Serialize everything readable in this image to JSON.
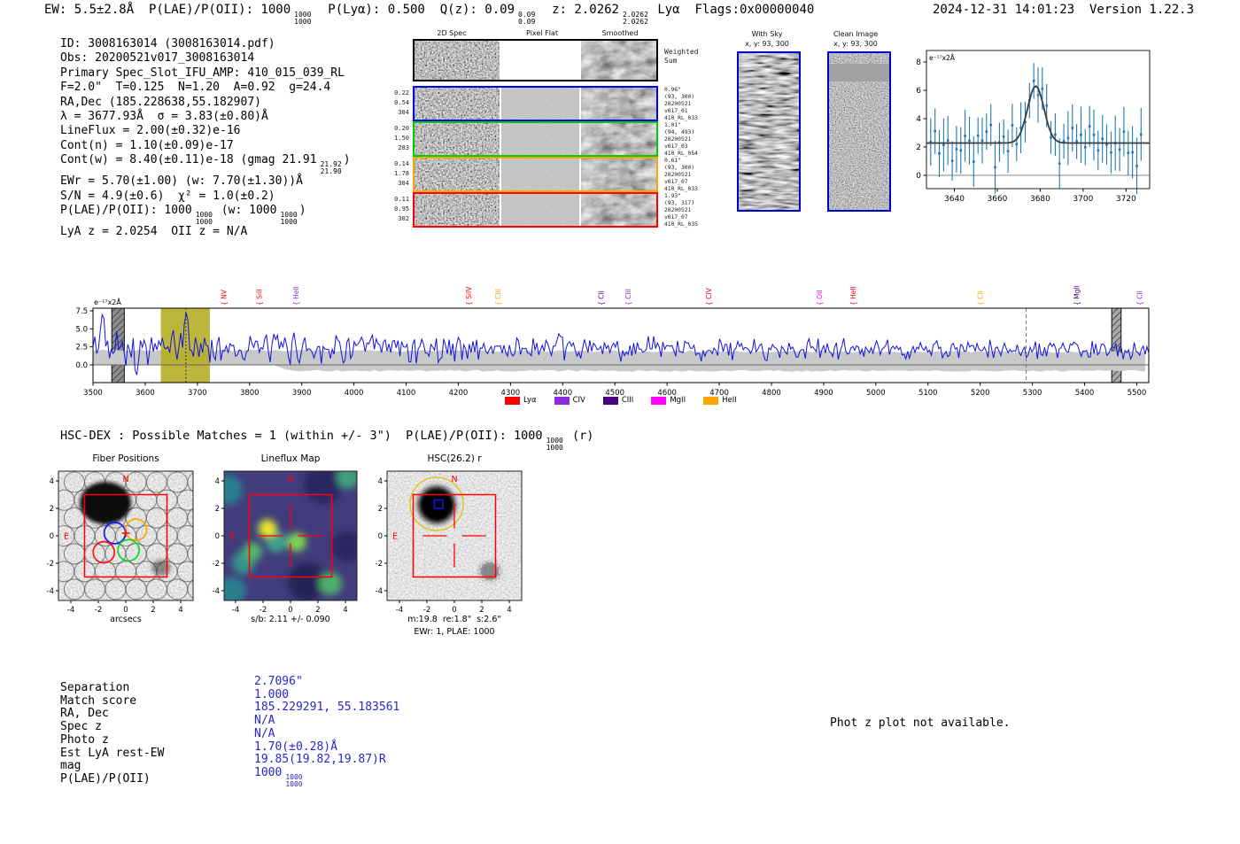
{
  "meta": {
    "stamp": "2024-12-31 14:01:23  Version 1.22.3"
  },
  "header_segments": [
    {
      "t": "EW: 5.5±2.8Å  P(LAE)/P(OII): 1000"
    },
    {
      "f": [
        "1000",
        "1000"
      ]
    },
    {
      "t": "  P(Lyα): 0.500  Q(z): 0.09"
    },
    {
      "f": [
        "0.09",
        "0.09"
      ]
    },
    {
      "t": "  z: 2.0262"
    },
    {
      "f": [
        "2.0262",
        "2.0262"
      ]
    },
    {
      "t": " Lyα  Flags:0x00000040"
    }
  ],
  "info_lines": [
    [
      {
        "t": "ID: 3008163014 (3008163014.pdf)"
      }
    ],
    [
      {
        "t": "Obs: 20200521v017_3008163014"
      }
    ],
    [
      {
        "t": "Primary Spec_Slot_IFU_AMP: 410_015_039_RL"
      }
    ],
    [
      {
        "t": "F=2.0\"  T=0.125  N=1.20  A=0.92  g=24.4"
      }
    ],
    [
      {
        "t": "RA,Dec (185.228638,55.182907)"
      }
    ],
    [
      {
        "t": "λ = 3677.93Å  σ = 3.83(±0.80)Å"
      }
    ],
    [
      {
        "t": "LineFlux = 2.00(±0.32)e-16"
      }
    ],
    [
      {
        "t": "Cont(n) = 1.10(±0.09)e-17"
      }
    ],
    [
      {
        "t": "Cont(w) = 8.40(±0.11)e-18 (gmag 21.91"
      },
      {
        "f": [
          "21.92",
          "21.90"
        ]
      },
      {
        "t": ")"
      }
    ],
    [
      {
        "t": "EWr = 5.70(±1.00) (w: 7.70(±1.30))Å"
      }
    ],
    [
      {
        "t": "S/N = 4.9(±0.6)  χ² = 1.0(±0.2)"
      }
    ],
    [
      {
        "t": "P(LAE)/P(OII): 1000"
      },
      {
        "f": [
          "1000",
          "1000"
        ]
      },
      {
        "t": " (w: 1000"
      },
      {
        "f": [
          "1000",
          "1000"
        ]
      },
      {
        "t": ")"
      }
    ],
    [
      {
        "t": "LyA z = 2.0254  OII z = N/A"
      }
    ]
  ],
  "spec2d": {
    "col_titles": [
      "2D Spec",
      "Pixel Flat",
      "Smoothed"
    ],
    "rows": [
      {
        "border": "#000000",
        "left": [],
        "right_lines": [
          "Weighted",
          "Sum"
        ]
      },
      {
        "border": "#0000ee",
        "left": [
          "0.22",
          "0.54",
          "304"
        ],
        "right_lines": [
          "0.96\"",
          "(93, 300)",
          "20200521",
          "v017_01",
          "410_RL_033"
        ]
      },
      {
        "border": "#00cc00",
        "left": [
          "0.20",
          "1.50",
          "283"
        ],
        "right_lines": [
          "1.01\"",
          "(94, 493)",
          "20200521",
          "v017_03",
          "410_RL_054"
        ]
      },
      {
        "border": "#ffa500",
        "left": [
          "0.14",
          "1.78",
          "304"
        ],
        "right_lines": [
          "0.61\"",
          "(93, 300)",
          "20200521",
          "v017_07",
          "410_RL_033"
        ]
      },
      {
        "border": "#ff0000",
        "left": [
          "0.11",
          "0.95",
          "302"
        ],
        "right_lines": [
          "1.93\"",
          "(93, 317)",
          "20200521",
          "v017_07",
          "410_RL_035"
        ]
      }
    ]
  },
  "sky_panels": [
    {
      "title": "With Sky",
      "subtitle": "x, y: 93, 300"
    },
    {
      "title": "Clean Image",
      "subtitle": "x, y: 93, 300"
    }
  ],
  "chart_data": [
    {
      "id": "emission-line-fit",
      "type": "scatter",
      "title": "",
      "xlabel": "",
      "ylabel": "e⁻¹⁷x2Å",
      "xlim": [
        3627,
        3731
      ],
      "ylim": [
        -0.94,
        8.81
      ],
      "xticks": [
        3640,
        3660,
        3680,
        3700,
        3720
      ],
      "yticks": [
        0,
        2,
        4,
        6,
        8
      ],
      "fit_curve": {
        "shape": "gaussian",
        "center": 3677.93,
        "sigma": 3.83,
        "baseline": 2.28,
        "peak": 6.3
      },
      "points": {
        "x_start": 3629,
        "x_step": 2,
        "count": 50,
        "baseline": 2.28,
        "scatter": 1.9,
        "typical_error": 1.55
      },
      "marker_color": "#1f77b4",
      "curve_color": "#3c3c3c",
      "grid": false
    },
    {
      "id": "full-spectrum",
      "type": "line",
      "title": "",
      "xlabel": "",
      "ylabel": "e⁻¹⁷x2Å",
      "xlim": [
        3500,
        5523
      ],
      "ylim": [
        -2.46,
        7.87
      ],
      "xticks": [
        3500,
        3600,
        3700,
        3800,
        3900,
        4000,
        4100,
        4200,
        4300,
        4400,
        4500,
        4600,
        4700,
        4800,
        4900,
        5000,
        5100,
        5200,
        5300,
        5400,
        5500
      ],
      "yticks": [
        0.0,
        2.5,
        5.0,
        7.5
      ],
      "line_color": "#1212e0",
      "baseline_flux": 2.3,
      "emission_peak": {
        "wavelength": 3677.93,
        "flux": 6.8
      },
      "extra_peak": {
        "wavelength": 3520,
        "flux": 7.3
      },
      "noise_band_color": "#c9c9c9",
      "highlight_band": {
        "x0": 3630,
        "x1": 3724,
        "color": "#b5ab20"
      },
      "dotted_line_x": 3677.93,
      "dashed_line_x": 5288,
      "hatched_bands": [
        [
          3536,
          3560
        ],
        [
          5452,
          5470
        ]
      ],
      "line_labels": [
        {
          "name": "NV",
          "wave": 3755,
          "color": "#ff0000"
        },
        {
          "name": "SiII",
          "wave": 3823,
          "color": "#ff0000"
        },
        {
          "name": "HeII",
          "wave": 3894,
          "color": "#8a2be2"
        },
        {
          "name": "SiIV",
          "wave": 4225,
          "color": "#ff0000"
        },
        {
          "name": "CIII",
          "wave": 4281,
          "color": "#ffa500"
        },
        {
          "name": "CII",
          "wave": 4478,
          "color": "#4b0082"
        },
        {
          "name": "CIII",
          "wave": 4530,
          "color": "#8a2be2"
        },
        {
          "name": "CIV",
          "wave": 4685,
          "color": "#ff0000"
        },
        {
          "name": "OII",
          "wave": 4897,
          "color": "#ff00ff"
        },
        {
          "name": "HeII",
          "wave": 4961,
          "color": "#ff0000"
        },
        {
          "name": "CII",
          "wave": 5205,
          "color": "#ffa500"
        },
        {
          "name": "MgII",
          "wave": 5390,
          "color": "#4b0082"
        },
        {
          "name": "CII",
          "wave": 5510,
          "color": "#8a2be2"
        }
      ],
      "legend": {
        "position": "bottom",
        "items": [
          {
            "label": "Lyα",
            "color": "#ff0000"
          },
          {
            "label": "CIV",
            "color": "#8a2be2"
          },
          {
            "label": "CIII",
            "color": "#4b0082"
          },
          {
            "label": "MgII",
            "color": "#ff00ff"
          },
          {
            "label": "HeII",
            "color": "#ffa500"
          }
        ]
      }
    }
  ],
  "hsc_segments": [
    {
      "t": "HSC-DEX : Possible Matches = 1 (within +/- 3\")  P(LAE)/P(OII): 1000"
    },
    {
      "f": [
        "1000",
        "1000"
      ]
    },
    {
      "t": " (r)"
    }
  ],
  "cutouts": {
    "axis_ticks": [
      -4,
      -2,
      0,
      2,
      4
    ],
    "compass": {
      "north": "N",
      "east": "E"
    },
    "panels": [
      {
        "title": "Fiber Positions",
        "captions": [
          "arcsecs"
        ]
      },
      {
        "title": "Lineflux Map",
        "captions": [
          "s/b: 2.11 +/- 0.090"
        ]
      },
      {
        "title": "HSC(26.2) r",
        "captions": [
          "m:19.8  re:1.8\"  s:2.6\"",
          "EWr: 1, PLAE: 1000"
        ]
      }
    ]
  },
  "match_table": {
    "rows": [
      {
        "label": "Separation",
        "value": [
          {
            "t": "2.7096\""
          }
        ]
      },
      {
        "label": "Match score",
        "value": [
          {
            "t": "1.000"
          }
        ]
      },
      {
        "label": "RA, Dec",
        "value": [
          {
            "t": "185.229291, 55.183561"
          }
        ]
      },
      {
        "label": "Spec z",
        "value": [
          {
            "t": "N/A"
          }
        ]
      },
      {
        "label": "Photo z",
        "value": [
          {
            "t": "N/A"
          }
        ]
      },
      {
        "label": "Est LyA rest-EW",
        "value": [
          {
            "t": "1.70(±0.28)Å"
          }
        ]
      },
      {
        "label": "mag",
        "value": [
          {
            "t": "19.85(19.82,19.87)R"
          }
        ]
      },
      {
        "label": "P(LAE)/P(OII)",
        "value": [
          {
            "t": "1000"
          },
          {
            "f": [
              "1000",
              "1000"
            ]
          }
        ]
      }
    ]
  },
  "photz_note": "Phot z plot not available."
}
